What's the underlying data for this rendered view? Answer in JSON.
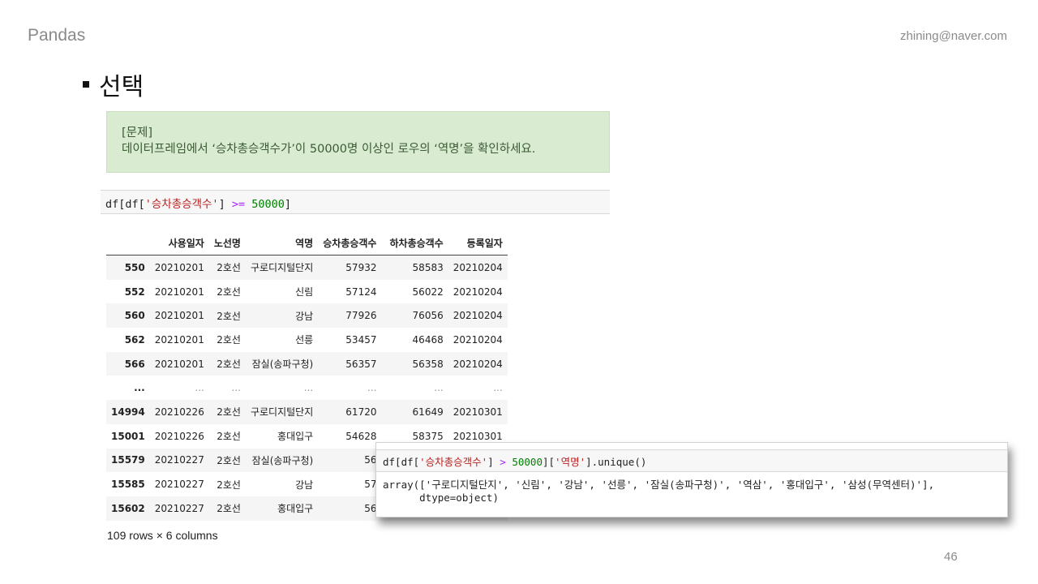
{
  "header": {
    "brand": "Pandas",
    "email": "zhining@naver.com"
  },
  "title": "선택",
  "problem": {
    "label": "[문제]",
    "text": "데이터프레임에서 ‘승차총승객수가’이 50000명 이상인 로우의 ‘역명’을 확인하세요."
  },
  "code1": {
    "p1": "df[df[",
    "s1": "'승차총승객수'",
    "p2": "] ",
    "op": ">=",
    "sp": " ",
    "num": "50000",
    "p3": "]"
  },
  "table": {
    "columns": [
      "",
      "사용일자",
      "노선명",
      "역명",
      "승차총승객수",
      "하차총승객수",
      "등록일자"
    ],
    "rows": [
      [
        "550",
        "20210201",
        "2호선",
        "구로디지털단지",
        "57932",
        "58583",
        "20210204"
      ],
      [
        "552",
        "20210201",
        "2호선",
        "신림",
        "57124",
        "56022",
        "20210204"
      ],
      [
        "560",
        "20210201",
        "2호선",
        "강남",
        "77926",
        "76056",
        "20210204"
      ],
      [
        "562",
        "20210201",
        "2호선",
        "선릉",
        "53457",
        "46468",
        "20210204"
      ],
      [
        "566",
        "20210201",
        "2호선",
        "잠실(송파구청)",
        "56357",
        "56358",
        "20210204"
      ],
      [
        "...",
        "...",
        "...",
        "...",
        "...",
        "...",
        "..."
      ],
      [
        "14994",
        "20210226",
        "2호선",
        "구로디지털단지",
        "61720",
        "61649",
        "20210301"
      ],
      [
        "15001",
        "20210226",
        "2호선",
        "홍대입구",
        "54628",
        "58375",
        "20210301"
      ],
      [
        "15579",
        "20210227",
        "2호선",
        "잠실(송파구청)",
        "56",
        "",
        ""
      ],
      [
        "15585",
        "20210227",
        "2호선",
        "강남",
        "57",
        "",
        ""
      ],
      [
        "15602",
        "20210227",
        "2호선",
        "홍대입구",
        "56",
        "",
        ""
      ]
    ],
    "summary": "109 rows × 6 columns"
  },
  "overlay": {
    "code": {
      "p1": "df[df[",
      "s1": "'승차총승객수'",
      "p2": "] ",
      "op": ">",
      "sp": " ",
      "num": "50000",
      "p3": "][",
      "s2": "'역명'",
      "p4": "].unique()"
    },
    "output_line1": "array(['구로디지털단지', '신림', '강남', '선릉', '잠실(송파구청)', '역삼', '홍대입구', '삼성(무역센터)'],",
    "output_line2": "      dtype=object)"
  },
  "page_number": "46"
}
